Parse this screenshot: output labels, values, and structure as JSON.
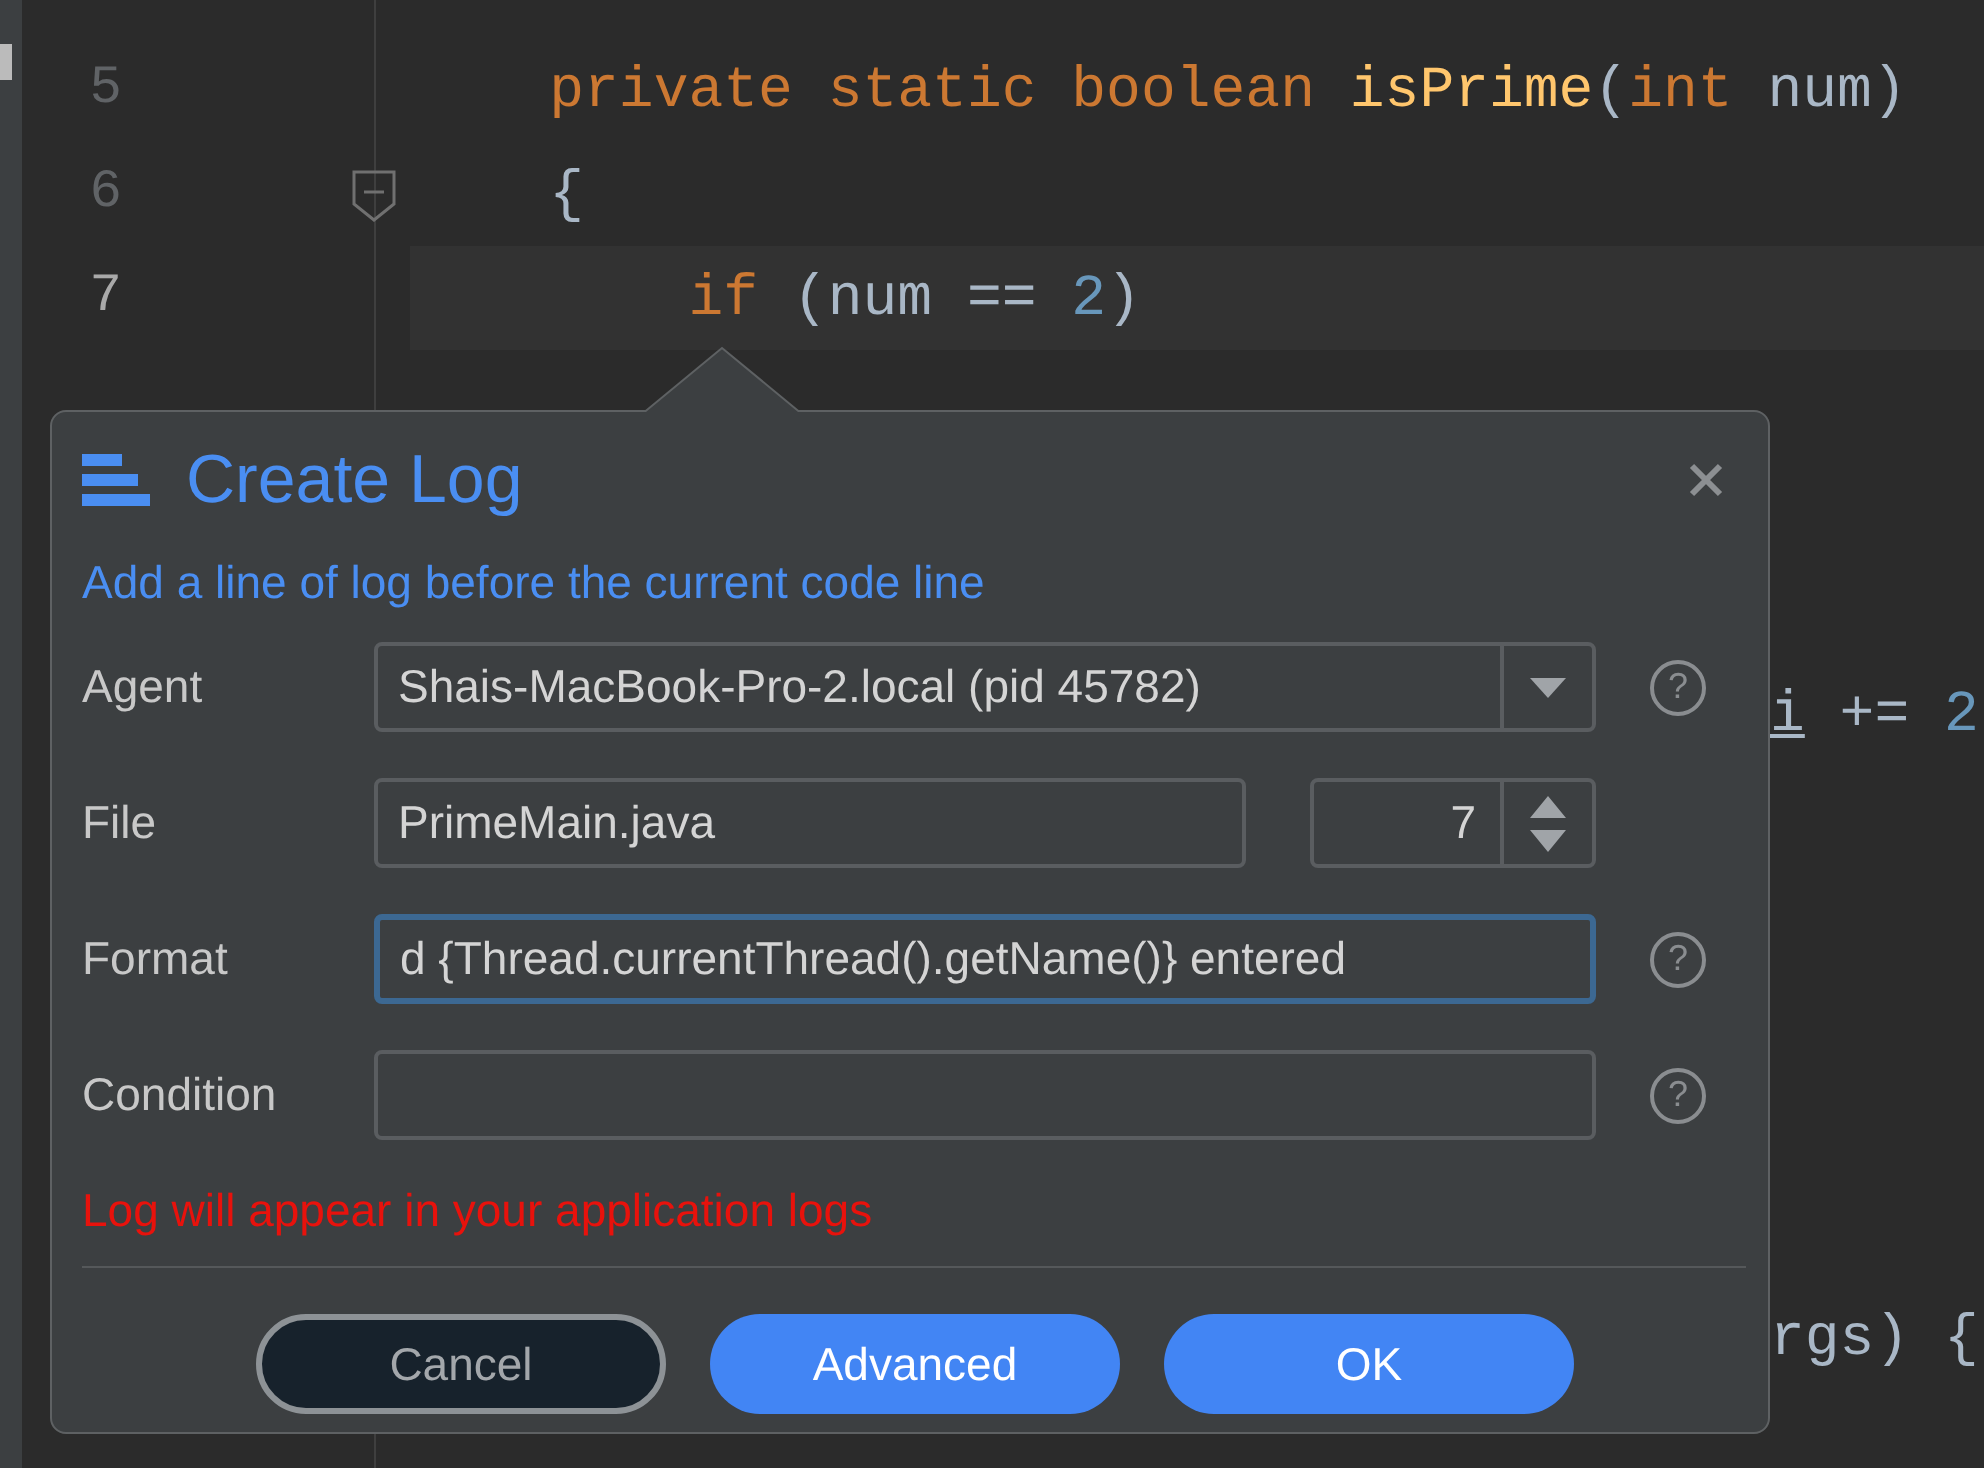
{
  "editor": {
    "lines": [
      {
        "number": "5",
        "current": false,
        "fold": false,
        "tokens": [
          {
            "kind": "keyword",
            "text": "    private static boolean "
          },
          {
            "kind": "method",
            "text": "isPrime"
          },
          {
            "kind": "plain",
            "text": "("
          },
          {
            "kind": "keyword",
            "text": "int"
          },
          {
            "kind": "plain",
            "text": " num)"
          }
        ]
      },
      {
        "number": "6",
        "current": false,
        "fold": true,
        "tokens": [
          {
            "kind": "plain",
            "text": "    {"
          }
        ]
      },
      {
        "number": "7",
        "current": true,
        "fold": false,
        "tokens": [
          {
            "kind": "keyword",
            "text": "        if"
          },
          {
            "kind": "plain",
            "text": " (num == "
          },
          {
            "kind": "number",
            "text": "2"
          },
          {
            "kind": "plain",
            "text": ")"
          }
        ]
      },
      {
        "current": false,
        "fold": false
      },
      {
        "current": false,
        "fold": false
      },
      {
        "current": false,
        "fold": false
      },
      {
        "current": false,
        "fold": false,
        "tail": [
          {
            "kind": "variable",
            "text": "i"
          },
          {
            "kind": "plain",
            "text": " += "
          },
          {
            "kind": "number",
            "text": "2"
          }
        ]
      },
      {
        "current": false,
        "fold": false
      },
      {
        "current": false,
        "fold": false
      },
      {
        "current": false,
        "fold": false
      },
      {
        "current": false,
        "fold": false
      },
      {
        "current": false,
        "fold": false
      },
      {
        "current": false,
        "fold": false,
        "tail": [
          {
            "kind": "plain",
            "text": "rgs) {"
          }
        ]
      }
    ]
  },
  "dialog": {
    "title": "Create Log",
    "subtitle": "Add a line of log before the current code line",
    "fields": [
      {
        "kind": "dropdown",
        "label": "Agent",
        "value": "Shais-MacBook-Pro-2.local (pid 45782)",
        "focused": false,
        "help": "?"
      },
      {
        "kind": "file",
        "label": "File",
        "value": "PrimeMain.java",
        "line": "7",
        "focused": false
      },
      {
        "kind": "text",
        "label": "Format",
        "value": "d {Thread.currentThread().getName()} entered",
        "focused": true,
        "help": "?"
      },
      {
        "kind": "text",
        "label": "Condition",
        "focused": false,
        "help": "?"
      }
    ],
    "warning": "Log will appear in your application logs",
    "buttons": [
      {
        "label": "Cancel",
        "primary": false
      },
      {
        "label": "Advanced",
        "primary": true
      },
      {
        "label": "OK",
        "primary": true
      }
    ]
  }
}
